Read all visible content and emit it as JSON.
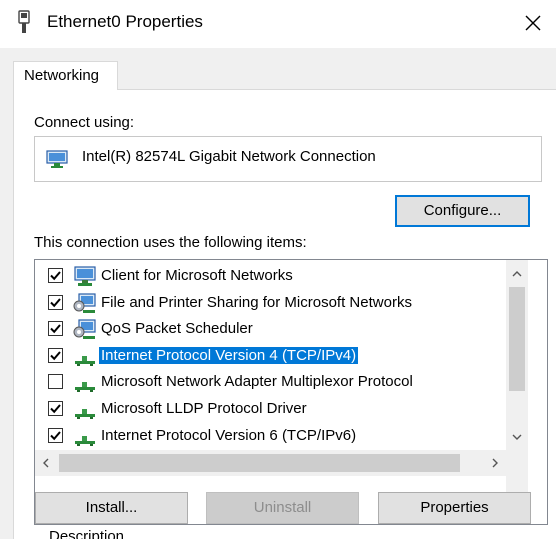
{
  "window": {
    "title": "Ethernet0 Properties"
  },
  "tabs": [
    {
      "label": "Networking"
    }
  ],
  "connect": {
    "label": "Connect using:",
    "adapter": "Intel(R) 82574L Gigabit Network Connection",
    "configure_label": "Configure..."
  },
  "items": {
    "label": "This connection uses the following items:",
    "list": [
      {
        "label": "Client for Microsoft Networks",
        "checked": true,
        "icon": "network-client-icon",
        "selected": false
      },
      {
        "label": "File and Printer Sharing for Microsoft Networks",
        "checked": true,
        "icon": "network-service-icon",
        "selected": false
      },
      {
        "label": "QoS Packet Scheduler",
        "checked": true,
        "icon": "network-service-icon",
        "selected": false
      },
      {
        "label": "Internet Protocol Version 4 (TCP/IPv4)",
        "checked": true,
        "icon": "network-protocol-icon",
        "selected": true
      },
      {
        "label": "Microsoft Network Adapter Multiplexor Protocol",
        "checked": false,
        "icon": "network-protocol-icon",
        "selected": false
      },
      {
        "label": "Microsoft LLDP Protocol Driver",
        "checked": true,
        "icon": "network-protocol-icon",
        "selected": false
      },
      {
        "label": "Internet Protocol Version 6 (TCP/IPv6)",
        "checked": true,
        "icon": "network-protocol-icon",
        "selected": false
      }
    ]
  },
  "buttons": {
    "install": "Install...",
    "uninstall": "Uninstall",
    "properties": "Properties"
  },
  "description": {
    "label": "Description"
  },
  "colors": {
    "selection": "#0078d7",
    "focus_border": "#0078d7"
  }
}
